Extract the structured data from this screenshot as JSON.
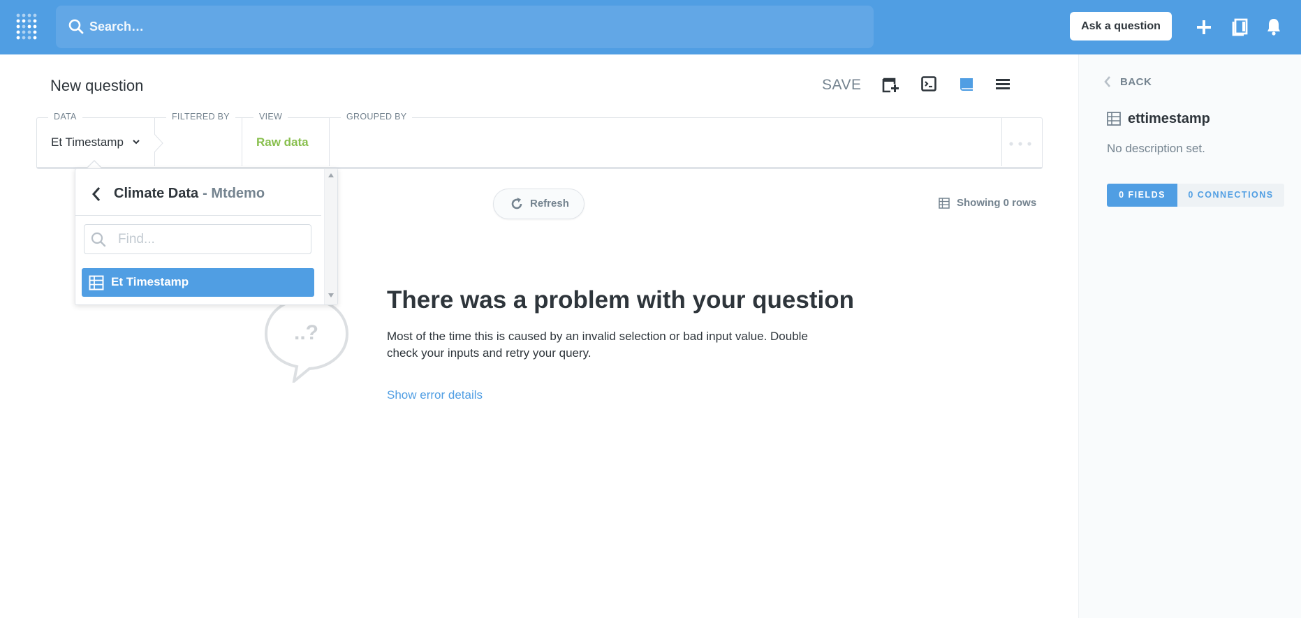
{
  "topnav": {
    "search_placeholder": "Search…",
    "ask_button": "Ask a question",
    "accent_color": "#509ee3"
  },
  "header": {
    "title": "New question",
    "save_label": "SAVE"
  },
  "query_builder": {
    "data_label": "DATA",
    "data_value": "Et Timestamp",
    "filtered_label": "FILTERED BY",
    "view_label": "VIEW",
    "view_value": "Raw data",
    "grouped_label": "GROUPED BY"
  },
  "results": {
    "refresh_label": "Refresh",
    "rows_label": "Showing 0 rows"
  },
  "error": {
    "bubble_text": "..?",
    "title": "There was a problem with your question",
    "body": "Most of the time this is caused by an invalid selection or bad input value. Double check your inputs and retry your query.",
    "details_link": "Show error details"
  },
  "popover": {
    "schema_title": "Climate Data",
    "database_name": "- Mtdemo",
    "find_placeholder": "Find...",
    "items": [
      {
        "label": "Et Timestamp",
        "selected": true
      }
    ]
  },
  "sidebar": {
    "back_label": "BACK",
    "table_name": "ettimestamp",
    "description": "No description set.",
    "tabs": [
      {
        "label": "0 FIELDS",
        "active": true
      },
      {
        "label": "0 CONNECTIONS",
        "active": false
      }
    ]
  }
}
